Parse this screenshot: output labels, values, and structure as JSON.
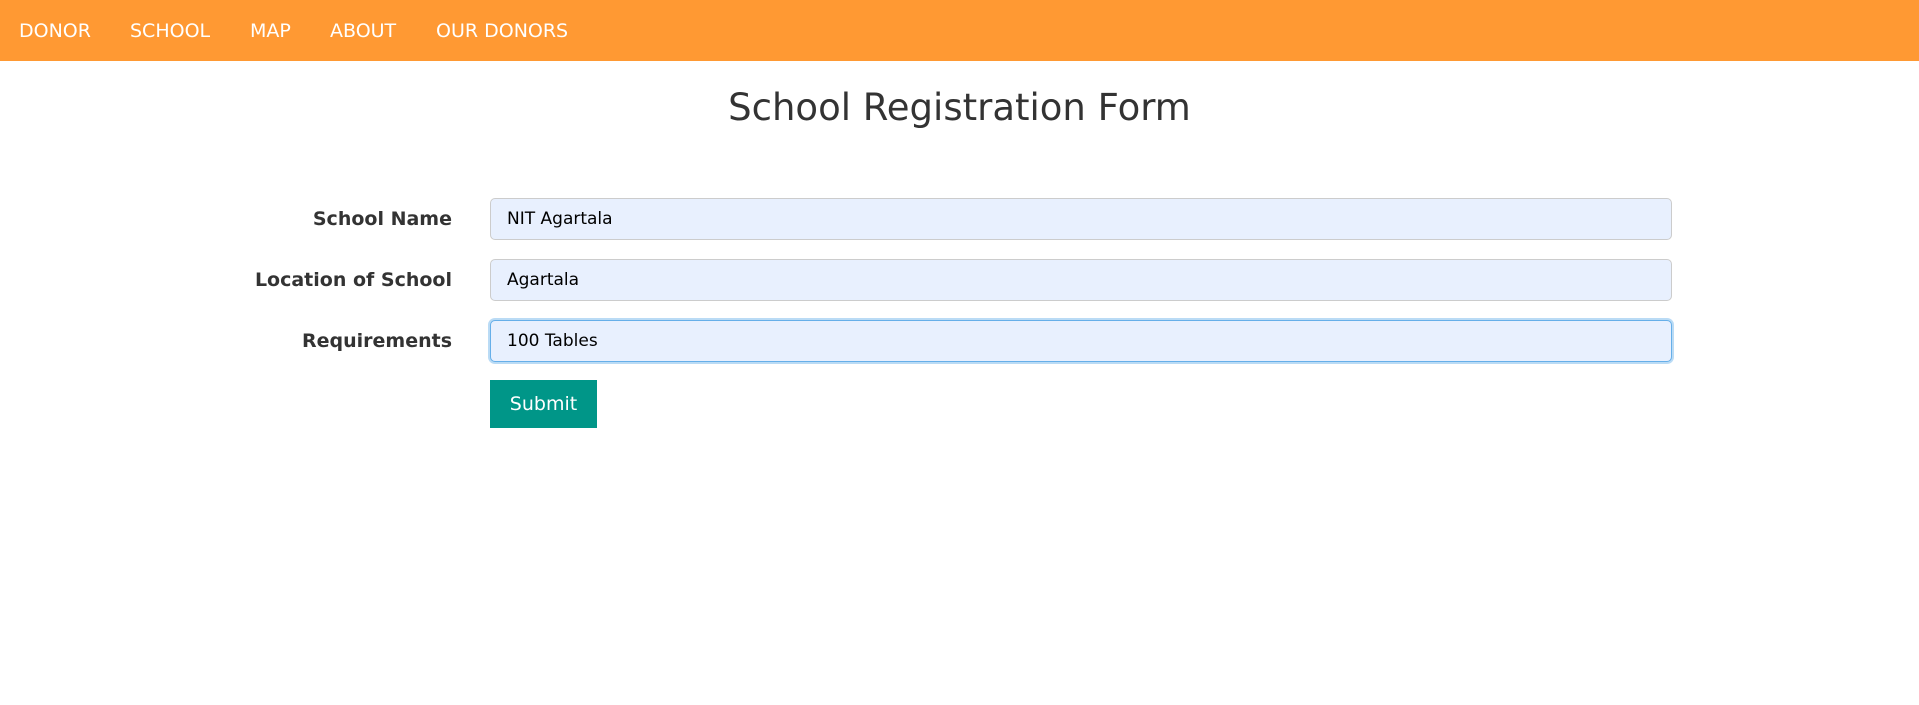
{
  "nav": {
    "items": [
      {
        "label": "DONOR"
      },
      {
        "label": "SCHOOL"
      },
      {
        "label": "MAP"
      },
      {
        "label": "ABOUT"
      },
      {
        "label": "OUR DONORS"
      }
    ]
  },
  "form": {
    "title": "School Registration Form",
    "fields": [
      {
        "label": "School Name",
        "value": "NIT Agartala"
      },
      {
        "label": "Location of School",
        "value": "Agartala"
      },
      {
        "label": "Requirements",
        "value": "100 Tables"
      }
    ],
    "submit_label": "Submit"
  },
  "colors": {
    "navbar": "#ff9933",
    "submit": "#009688",
    "input_fill": "#e8f0fe"
  }
}
